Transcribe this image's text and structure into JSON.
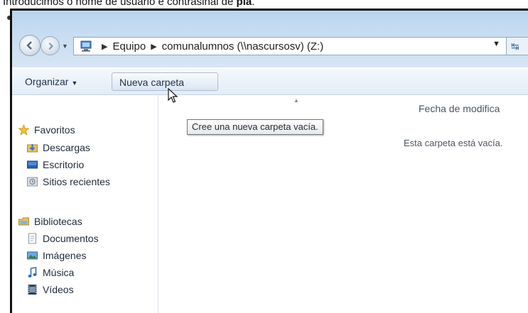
{
  "caption": {
    "prefix": "Introducimos o nome de usuario e contrasinal de ",
    "bold": "pla",
    "suffix": "."
  },
  "address_bar": {
    "segments": [
      "Equipo",
      "comunalumnos (\\\\nascursosv) (Z:)"
    ]
  },
  "toolbar": {
    "organize_label": "Organizar",
    "new_folder_label": "Nueva carpeta"
  },
  "tooltip": "Cree una nueva carpeta vacía.",
  "nav_pane": {
    "favorites": {
      "title": "Favoritos",
      "items": [
        "Descargas",
        "Escritorio",
        "Sitios recientes"
      ]
    },
    "libraries": {
      "title": "Bibliotecas",
      "items": [
        "Documentos",
        "Imágenes",
        "Música",
        "Vídeos"
      ]
    }
  },
  "content": {
    "column_header": "Fecha de modifica",
    "empty_message": "Esta carpeta está vacía."
  },
  "colors": {
    "chrome": "#c9ddf2",
    "toolbar": "#e3ecf7",
    "accent": "#4b76a6"
  }
}
